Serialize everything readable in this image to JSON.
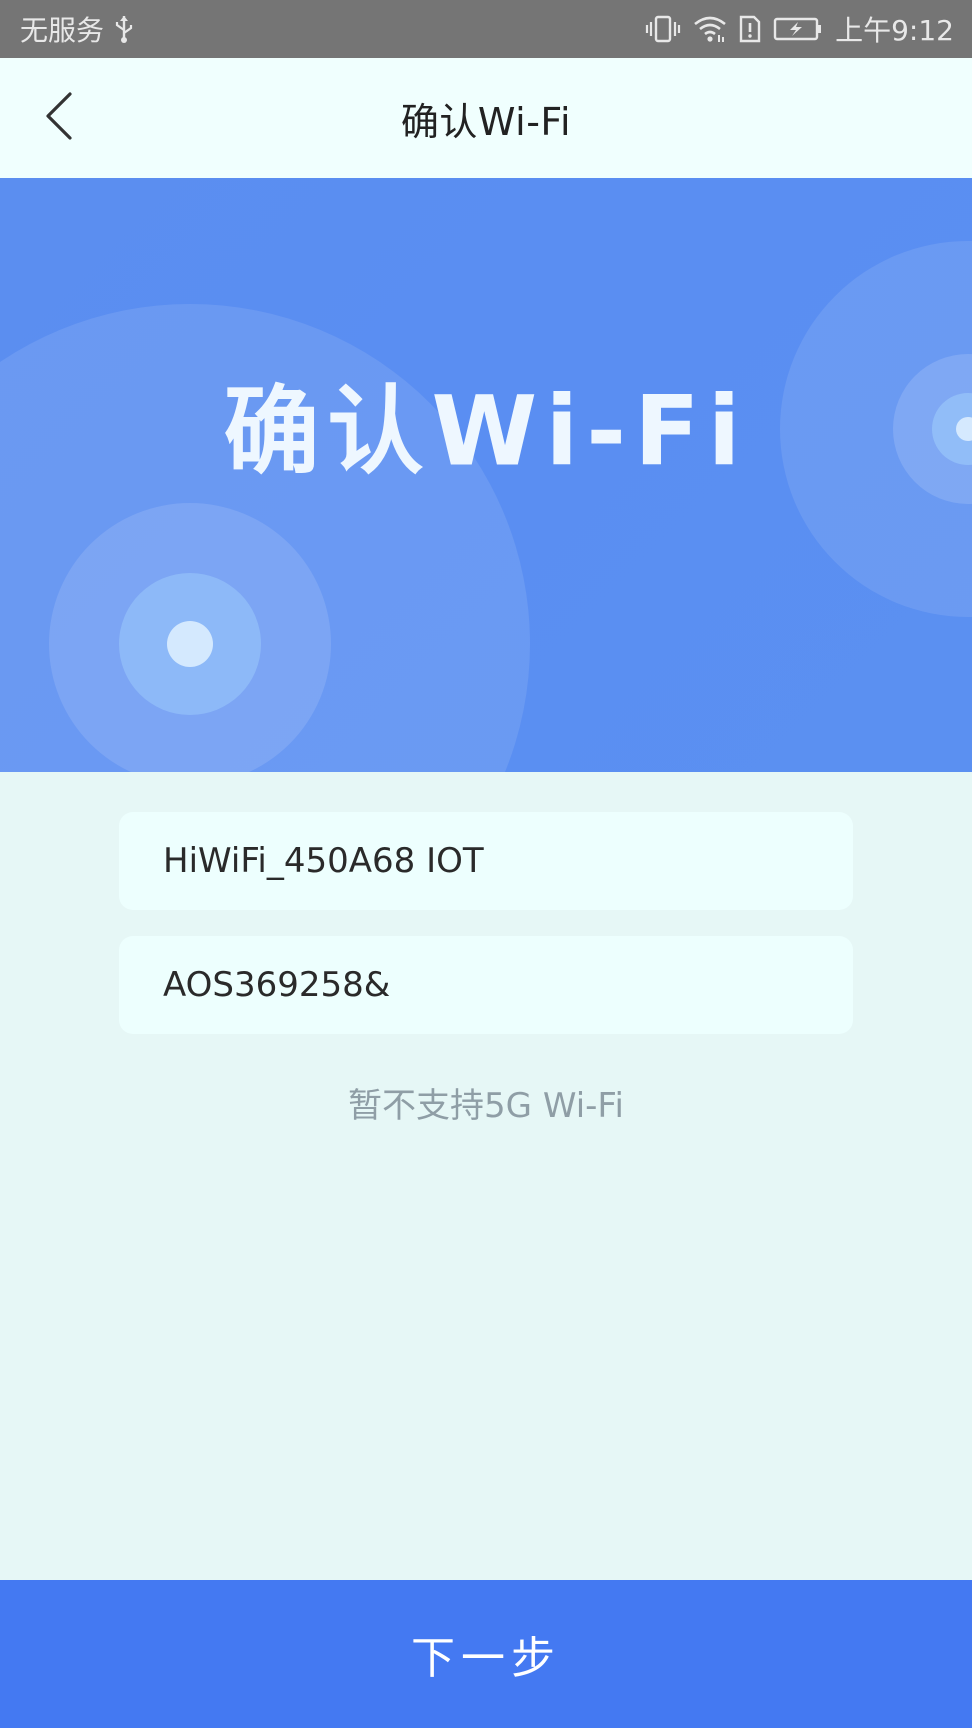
{
  "status_bar": {
    "carrier": "无服务",
    "time": "上午9:12",
    "icons": [
      "usb-icon",
      "vibrate-icon",
      "wifi-icon",
      "sim-alert-icon",
      "battery-charging-icon"
    ]
  },
  "header": {
    "title": "确认Wi-Fi",
    "back_icon": "chevron-left-icon"
  },
  "banner": {
    "title": "确认Wi-Fi"
  },
  "form": {
    "ssid_value": "HiWiFi_450A68 IOT",
    "password_value": "AOS369258&",
    "notice": "暂不支持5G Wi-Fi"
  },
  "footer": {
    "next_label": "下一步"
  },
  "colors": {
    "status_bar": "#757575",
    "header_bg": "#f0fffe",
    "banner_bg": "#5a8ef2",
    "page_bg": "#e6f7f6",
    "primary_button": "#4479f2"
  }
}
